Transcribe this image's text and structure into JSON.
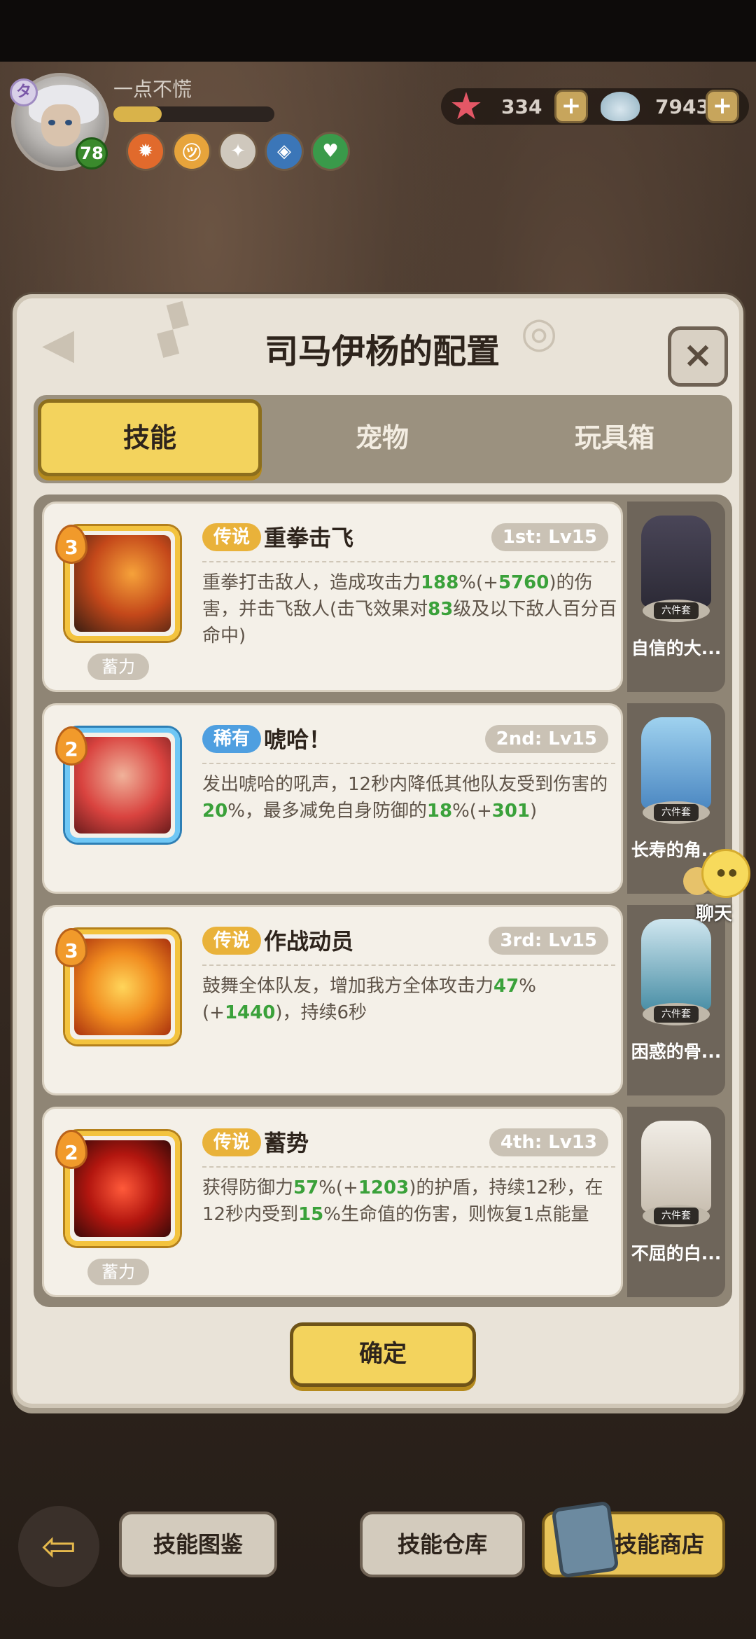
{
  "hud": {
    "player_name": "一点不慌",
    "level": "78",
    "profile_badge": "タ",
    "exp_progress": 0.3,
    "starfish_count": "334",
    "shell_count": "7943",
    "plus_label": "+"
  },
  "modal": {
    "title": "司马伊杨的配置",
    "close_label": "×",
    "tabs": [
      "技能",
      "宠物",
      "玩具箱"
    ],
    "confirm_label": "确定"
  },
  "skills": [
    {
      "rarity": "传说",
      "name": "重拳击飞",
      "slot": "1st: Lv15",
      "stack": "3",
      "charge": "蓄力",
      "desc_parts": [
        "重拳打击敌人，造成攻击力",
        "188",
        "%(+",
        "5760",
        ")的伤害，并击飞敌人(击飞效果对",
        "83",
        "级及以下敌人百分百命中)"
      ],
      "pet_name": "自信的大...",
      "pet_tag": "六件套"
    },
    {
      "rarity": "稀有",
      "name": "唬哈！",
      "slot": "2nd: Lv15",
      "stack": "2",
      "charge": "",
      "desc_parts": [
        "发出唬哈的吼声，12秒内降低其他队友受到伤害的",
        "20",
        "%，最多减免自身防御的",
        "18",
        "%(+",
        "301",
        ")"
      ],
      "pet_name": "长寿的角...",
      "pet_tag": "六件套"
    },
    {
      "rarity": "传说",
      "name": "作战动员",
      "slot": "3rd: Lv15",
      "stack": "3",
      "charge": "",
      "desc_parts": [
        "鼓舞全体队友，增加我方全体攻击力",
        "47",
        "%(+",
        "1440",
        ")，持续6秒"
      ],
      "pet_name": "困惑的骨...",
      "pet_tag": "六件套"
    },
    {
      "rarity": "传说",
      "name": "蓄势",
      "slot": "4th: Lv13",
      "stack": "2",
      "charge": "蓄力",
      "desc_parts": [
        "获得防御力",
        "57",
        "%(+",
        "1203",
        ")的护盾，持续12秒，在12秒内受到",
        "15",
        "%生命值的伤害，则恢复1点能量"
      ],
      "pet_name": "不屈的白...",
      "pet_tag": "六件套"
    }
  ],
  "chat_label": "聊天",
  "bottom": {
    "back_arrow": "⇦",
    "catalog": "技能图鉴",
    "warehouse": "技能仓库",
    "shop": "技能商店"
  },
  "colors": {
    "accent_yellow": "#f3d35d",
    "legend": "#e9b23a",
    "rare": "#4f9fe0",
    "number_green": "#3aa13a"
  }
}
